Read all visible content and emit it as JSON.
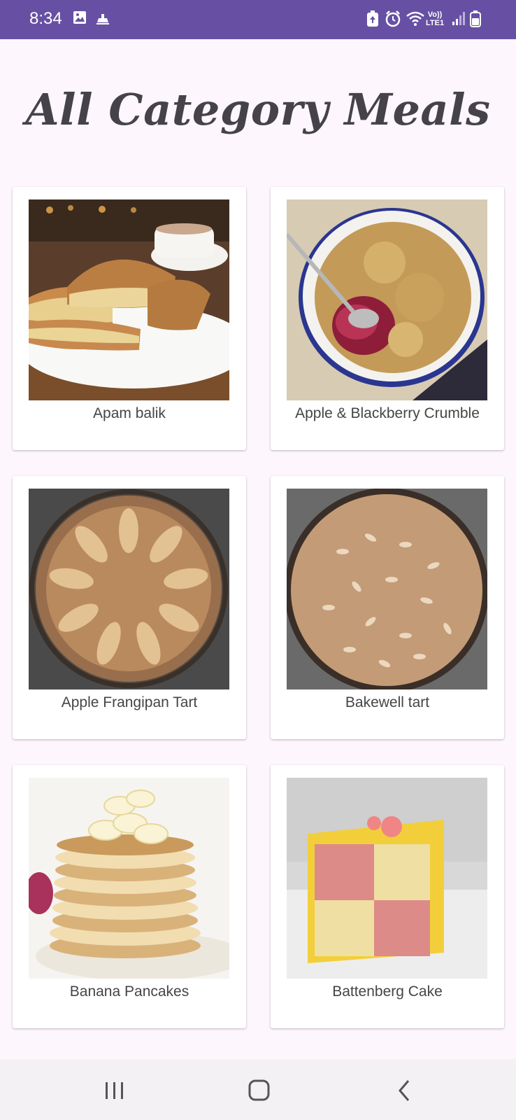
{
  "status_bar": {
    "time": "8:34",
    "icons_left": [
      "gallery-icon",
      "notification-icon"
    ],
    "icons_right": [
      "battery-saver-icon",
      "alarm-icon",
      "wifi-icon",
      "volte-lte1-icon",
      "signal-icon",
      "battery-icon"
    ],
    "network_top": "Vo))",
    "network_bottom": "LTE1"
  },
  "page": {
    "title": "All Category Meals"
  },
  "meals": [
    {
      "name": "Apam balik",
      "image": "apam-balik-photo"
    },
    {
      "name": "Apple & Blackberry Crumble",
      "image": "apple-blackberry-crumble-photo"
    },
    {
      "name": "Apple Frangipan Tart",
      "image": "apple-frangipan-tart-photo"
    },
    {
      "name": "Bakewell tart",
      "image": "bakewell-tart-photo"
    },
    {
      "name": "Banana Pancakes",
      "image": "banana-pancakes-photo"
    },
    {
      "name": "Battenberg Cake",
      "image": "battenberg-cake-photo"
    }
  ],
  "nav_bar": {
    "buttons": [
      "recent-apps-icon",
      "home-icon",
      "back-icon"
    ]
  },
  "colors": {
    "status_bar": "#6750a4",
    "background": "#fdf7fd",
    "title": "#45424a",
    "card": "#ffffff",
    "nav_bar": "#f3f1f3"
  }
}
